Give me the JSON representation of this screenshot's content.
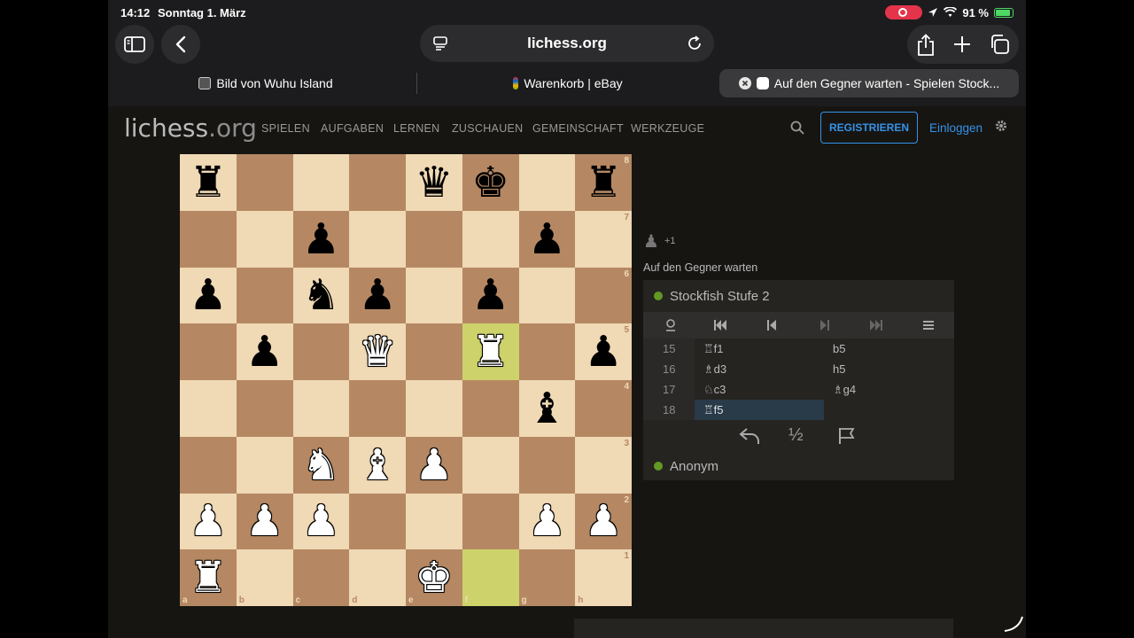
{
  "status": {
    "time": "14:12",
    "date": "Sonntag 1. März",
    "battery": "91 %"
  },
  "safari": {
    "url": "lichess.org",
    "tabs": [
      {
        "title": "Bild von Wuhu Island",
        "active": false
      },
      {
        "title": "Warenkorb | eBay",
        "active": false
      },
      {
        "title": "Auf den Gegner warten - Spielen Stock...",
        "active": true
      }
    ]
  },
  "site": {
    "logo": "lichess",
    "logo_tld": ".org",
    "nav": [
      "SPIELEN",
      "AUFGABEN",
      "LERNEN",
      "ZUSCHAUEN",
      "GEMEINSCHAFT",
      "WERKZEUGE"
    ],
    "register": "REGISTRIEREN",
    "login": "Einloggen"
  },
  "board": {
    "ranks": [
      "8",
      "7",
      "6",
      "5",
      "4",
      "3",
      "2",
      "1"
    ],
    "files": [
      "a",
      "b",
      "c",
      "d",
      "e",
      "f",
      "g",
      "h"
    ],
    "position": [
      [
        "bR",
        "",
        "",
        "",
        "bQ",
        "bK",
        "",
        "bR"
      ],
      [
        "",
        "",
        "bP",
        "",
        "",
        "",
        "bP",
        ""
      ],
      [
        "bP",
        "",
        "bN",
        "bP",
        "",
        "bP",
        "",
        ""
      ],
      [
        "",
        "bP",
        "",
        "wQ",
        "",
        "wR",
        "",
        "bP"
      ],
      [
        "",
        "",
        "",
        "",
        "",
        "",
        "bB",
        ""
      ],
      [
        "",
        "",
        "wN",
        "wB",
        "wP",
        "",
        "",
        ""
      ],
      [
        "wP",
        "wP",
        "wP",
        "",
        "",
        "",
        "wP",
        "wP"
      ],
      [
        "wR",
        "",
        "",
        "",
        "wK",
        "",
        "",
        ""
      ]
    ],
    "highlight": [
      "f5",
      "f1"
    ]
  },
  "game": {
    "captured_piece": "♟",
    "captured_count": "+1",
    "status_text": "Auf den Gegner warten",
    "opponent": "Stockfish Stufe 2",
    "player": "Anonym",
    "moves": [
      {
        "num": "15",
        "white": "♖f1",
        "black": "b5"
      },
      {
        "num": "16",
        "white": "♗d3",
        "black": "h5"
      },
      {
        "num": "17",
        "white": "♘c3",
        "black": "♗g4"
      },
      {
        "num": "18",
        "white": "♖f5",
        "black": ""
      }
    ],
    "active_move": "18w",
    "draw_label": "½"
  }
}
